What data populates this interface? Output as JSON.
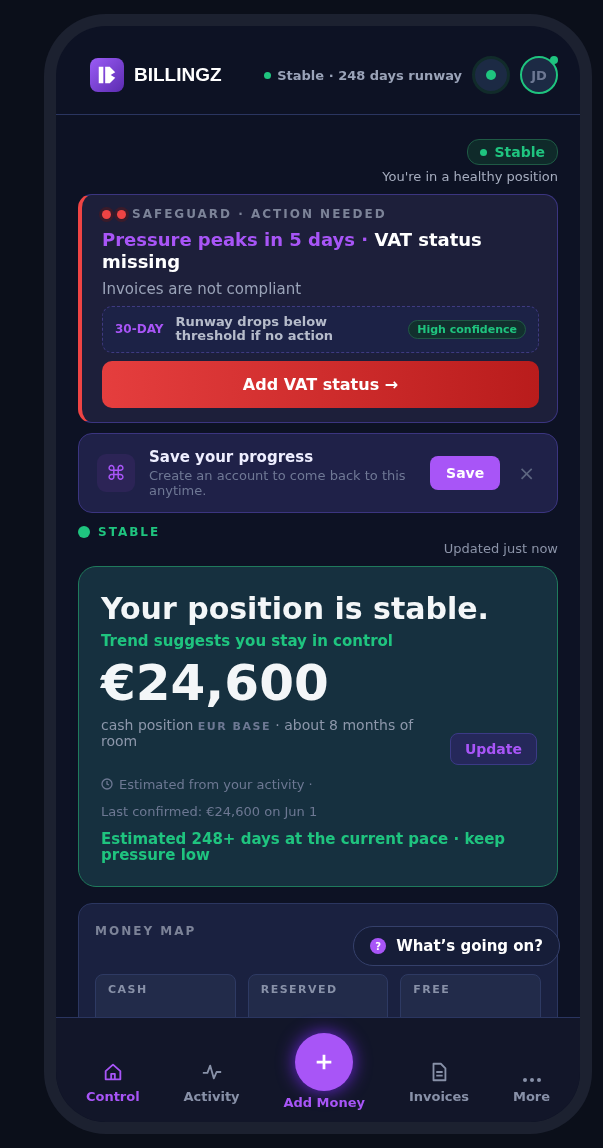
{
  "brand": {
    "name": "BILLINGZ"
  },
  "header": {
    "status": "Stable · 248 days runway",
    "avatar": "JD",
    "online": true
  },
  "status_pill": {
    "label": "Stable",
    "note": "You're in a healthy position"
  },
  "alert": {
    "eyebrow": "SAFEGUARD · ACTION NEEDED",
    "headline_lead": "Pressure peaks in 5 days ·",
    "headline_rest": "VAT status missing",
    "subtitle": "Invoices are not compliant",
    "forecast": {
      "period": "30-DAY",
      "text": "Runway drops below threshold if no action",
      "confidence": "High confidence"
    },
    "action": "Add VAT status →"
  },
  "save_prompt": {
    "icon": "⌘",
    "title": "Save your progress",
    "text": "Create an account to come back to this anytime.",
    "button": "Save",
    "close": "×"
  },
  "section": {
    "label": "STABLE",
    "updated": "Updated just now"
  },
  "position": {
    "title": "Your position is stable.",
    "trend": "Trend suggests you stay in control",
    "amount": "€24,600",
    "caption": "cash position",
    "base": "EUR BASE",
    "room": "· about 8 months of room",
    "update": "Update",
    "estimated": "Estimated from your activity ·",
    "confirmed": "Last confirmed: €24,600 on Jun 1",
    "runway": "Estimated 248+ days at the current pace · keep pressure low"
  },
  "money_map": {
    "title": "MONEY MAP",
    "tiles": [
      {
        "label": "CASH"
      },
      {
        "label": "RESERVED"
      },
      {
        "label": "FREE"
      }
    ]
  },
  "help": {
    "icon": "?",
    "label": "What’s going on?"
  },
  "nav": [
    {
      "kind": "tab",
      "label": "Control",
      "selected": true
    },
    {
      "kind": "tab",
      "label": "Activity",
      "selected": false
    },
    {
      "kind": "fab",
      "label": "Add Money"
    },
    {
      "kind": "tab",
      "label": "Invoices",
      "selected": false
    },
    {
      "kind": "tab",
      "label": "More",
      "selected": false
    }
  ]
}
